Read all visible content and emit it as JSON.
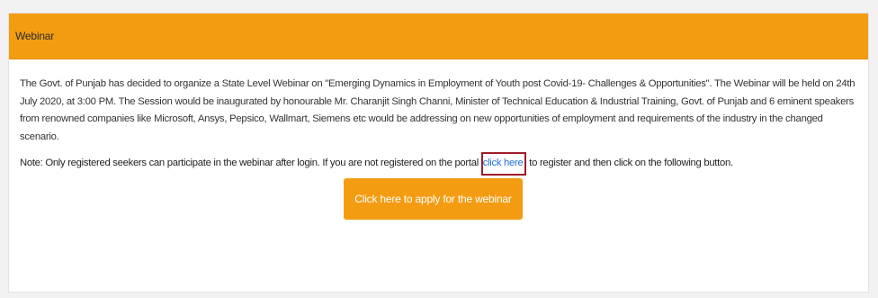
{
  "panel": {
    "title": "Webinar"
  },
  "body": {
    "description": "The Govt. of Punjab has decided to organize a State Level Webinar on \"Emerging Dynamics in Employment of Youth post Covid-19- Challenges & Opportunities\". The Webinar will be held on 24th July 2020, at 3:00 PM. The Session would be inaugurated by honourable Mr. Charanjit Singh Channi, Minister of Technical Education & Industrial Training, Govt. of Punjab and 6 eminent speakers from renowned companies like Microsoft, Ansys, Pepsico, Wallmart, Siemens etc would be addressing on new opportunities of employment and requirements of the industry in the changed scenario.",
    "note_before": "Note: Only registered seekers can participate in the webinar after login. If you are not registered on the portal ",
    "note_link": "click here",
    "note_after": " to register and then click on the following button.",
    "apply_button": "Click here to apply for the webinar"
  },
  "colors": {
    "accent": "#f39c12",
    "link": "#1f6fd6",
    "highlight_box": "#a01c2a"
  }
}
